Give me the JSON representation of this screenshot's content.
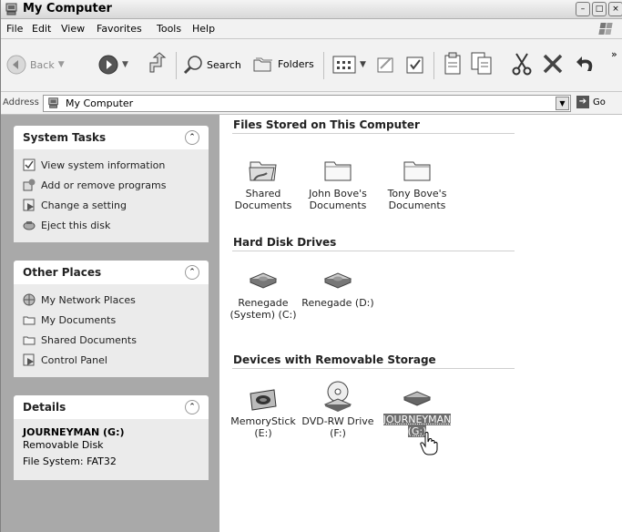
{
  "window": {
    "title": "My Computer",
    "icon": "my-computer-icon"
  },
  "menu": [
    "File",
    "Edit",
    "View",
    "Favorites",
    "Tools",
    "Help"
  ],
  "toolbar": {
    "back_label": "Back",
    "search_label": "Search",
    "folders_label": "Folders",
    "overflow": "»"
  },
  "address": {
    "label": "Address",
    "value": "My Computer",
    "go_label": "Go"
  },
  "system_tasks": {
    "title": "System Tasks",
    "items": [
      {
        "label": "View system information",
        "icon": "system-info-icon"
      },
      {
        "label": "Add or remove programs",
        "icon": "add-remove-icon"
      },
      {
        "label": "Change a setting",
        "icon": "control-panel-icon"
      },
      {
        "label": "Eject this disk",
        "icon": "eject-icon"
      }
    ]
  },
  "other_places": {
    "title": "Other Places",
    "items": [
      {
        "label": "My Network Places",
        "icon": "network-icon"
      },
      {
        "label": "My Documents",
        "icon": "folder-icon"
      },
      {
        "label": "Shared Documents",
        "icon": "folder-icon"
      },
      {
        "label": "Control Panel",
        "icon": "control-panel-icon"
      }
    ]
  },
  "details": {
    "title": "Details",
    "name": "JOURNEYMAN (G:)",
    "type": "Removable Disk",
    "filesystem": "File System: FAT32"
  },
  "groups": {
    "files": {
      "title": "Files Stored on This Computer",
      "items": [
        {
          "label": "Shared Documents"
        },
        {
          "label": "John Bove's Documents"
        },
        {
          "label": "Tony Bove's Documents"
        }
      ]
    },
    "drives": {
      "title": "Hard Disk Drives",
      "items": [
        {
          "label": "Renegade (System) (C:)"
        },
        {
          "label": "Renegade (D:)"
        }
      ]
    },
    "removable": {
      "title": "Devices with Removable Storage",
      "items": [
        {
          "label": "MemoryStick (E:)"
        },
        {
          "label": "DVD-RW Drive (F:)"
        },
        {
          "label": "JOURNEYMAN (G:)",
          "selected": true
        }
      ]
    }
  }
}
